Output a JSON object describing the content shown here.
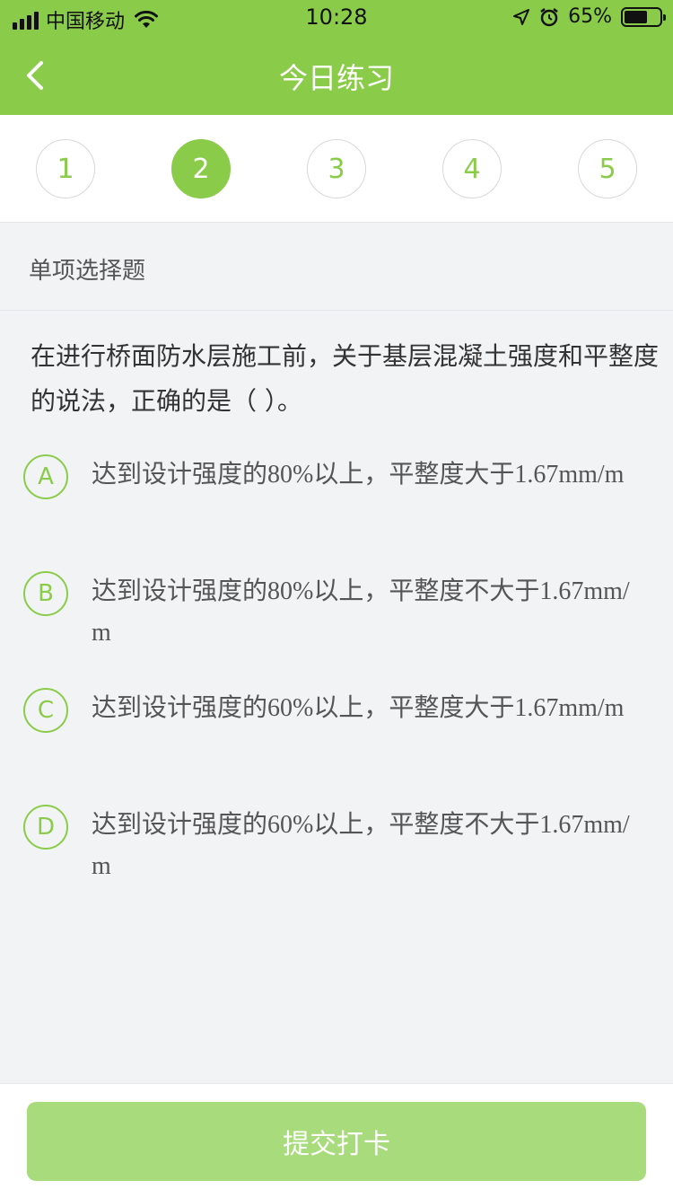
{
  "status_bar": {
    "carrier": "中国移动",
    "time": "10:28",
    "battery": "65%",
    "battery_level": 0.65,
    "icons": [
      "signal-icon",
      "wifi-icon",
      "location-icon",
      "alarm-icon",
      "battery-icon"
    ]
  },
  "nav": {
    "title": "今日练习",
    "back_icon": "chevron-left-icon"
  },
  "question_numbers": [
    "1",
    "2",
    "3",
    "4",
    "5"
  ],
  "active_question": "2",
  "question_type": "单项选择题",
  "question": {
    "text": "在进行桥面防水层施工前，关于基层混凝土强度和平整度的说法，正确的是（    ）。"
  },
  "options": [
    {
      "letter": "A",
      "text": "达到设计强度的80%以上，平整度大于1.67mm/m"
    },
    {
      "letter": "B",
      "text": "达到设计强度的80%以上，平整度不大于1.67mm/m"
    },
    {
      "letter": "C",
      "text": "达到设计强度的60%以上，平整度大于1.67mm/m"
    },
    {
      "letter": "D",
      "text": "达到设计强度的60%以上，平整度不大于1.67mm/m"
    }
  ],
  "footer": {
    "submit_label": "提交打卡"
  },
  "colors": {
    "accent": "#8acc4a",
    "button_disabled": "#a8db7c",
    "background": "#f2f3f5"
  }
}
